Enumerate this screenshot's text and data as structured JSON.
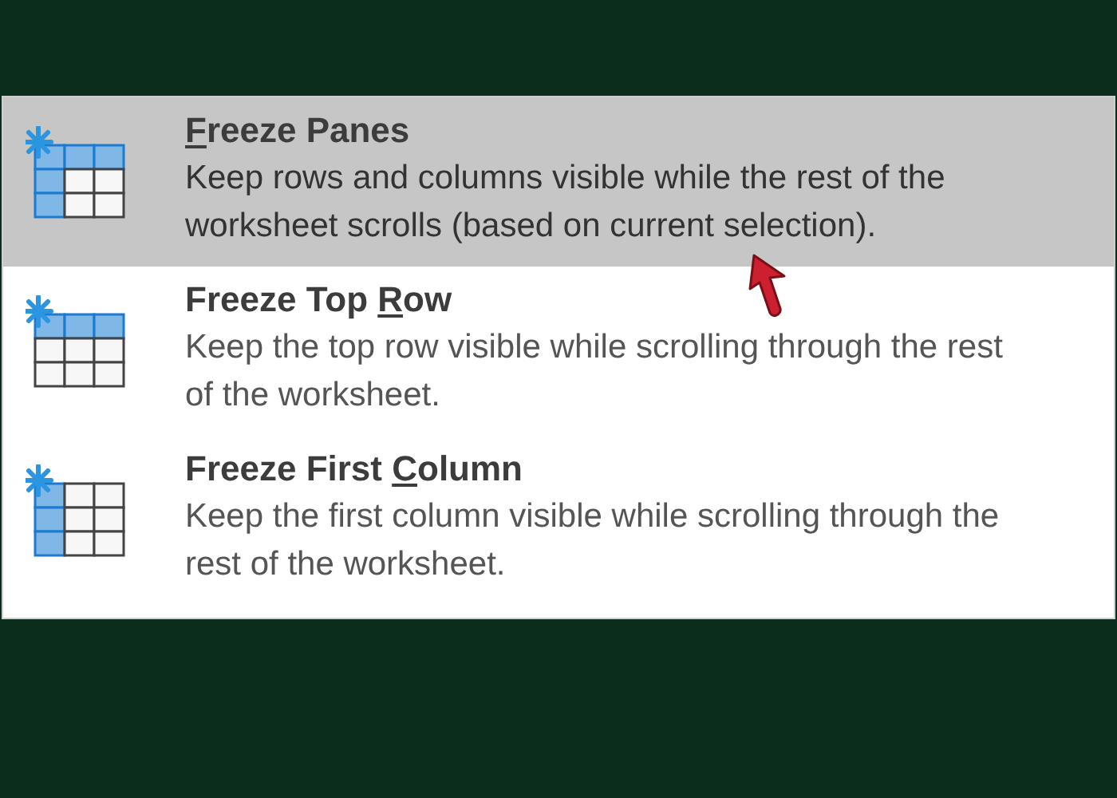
{
  "menu": {
    "items": [
      {
        "kind": "panes",
        "access_key": "F",
        "title_after": "reeze Panes",
        "description": "Keep rows and columns visible while the rest of the worksheet scrolls (based on current selection).",
        "selected": true
      },
      {
        "kind": "top_row",
        "title_before": "Freeze Top ",
        "access_key": "R",
        "title_after": "ow",
        "description": "Keep the top row visible while scrolling through the rest of the worksheet.",
        "selected": false
      },
      {
        "kind": "first_column",
        "title_before": "Freeze First ",
        "access_key": "C",
        "title_after": "olumn",
        "description": "Keep the first column visible while scrolling through the rest of the worksheet.",
        "selected": false
      }
    ]
  }
}
